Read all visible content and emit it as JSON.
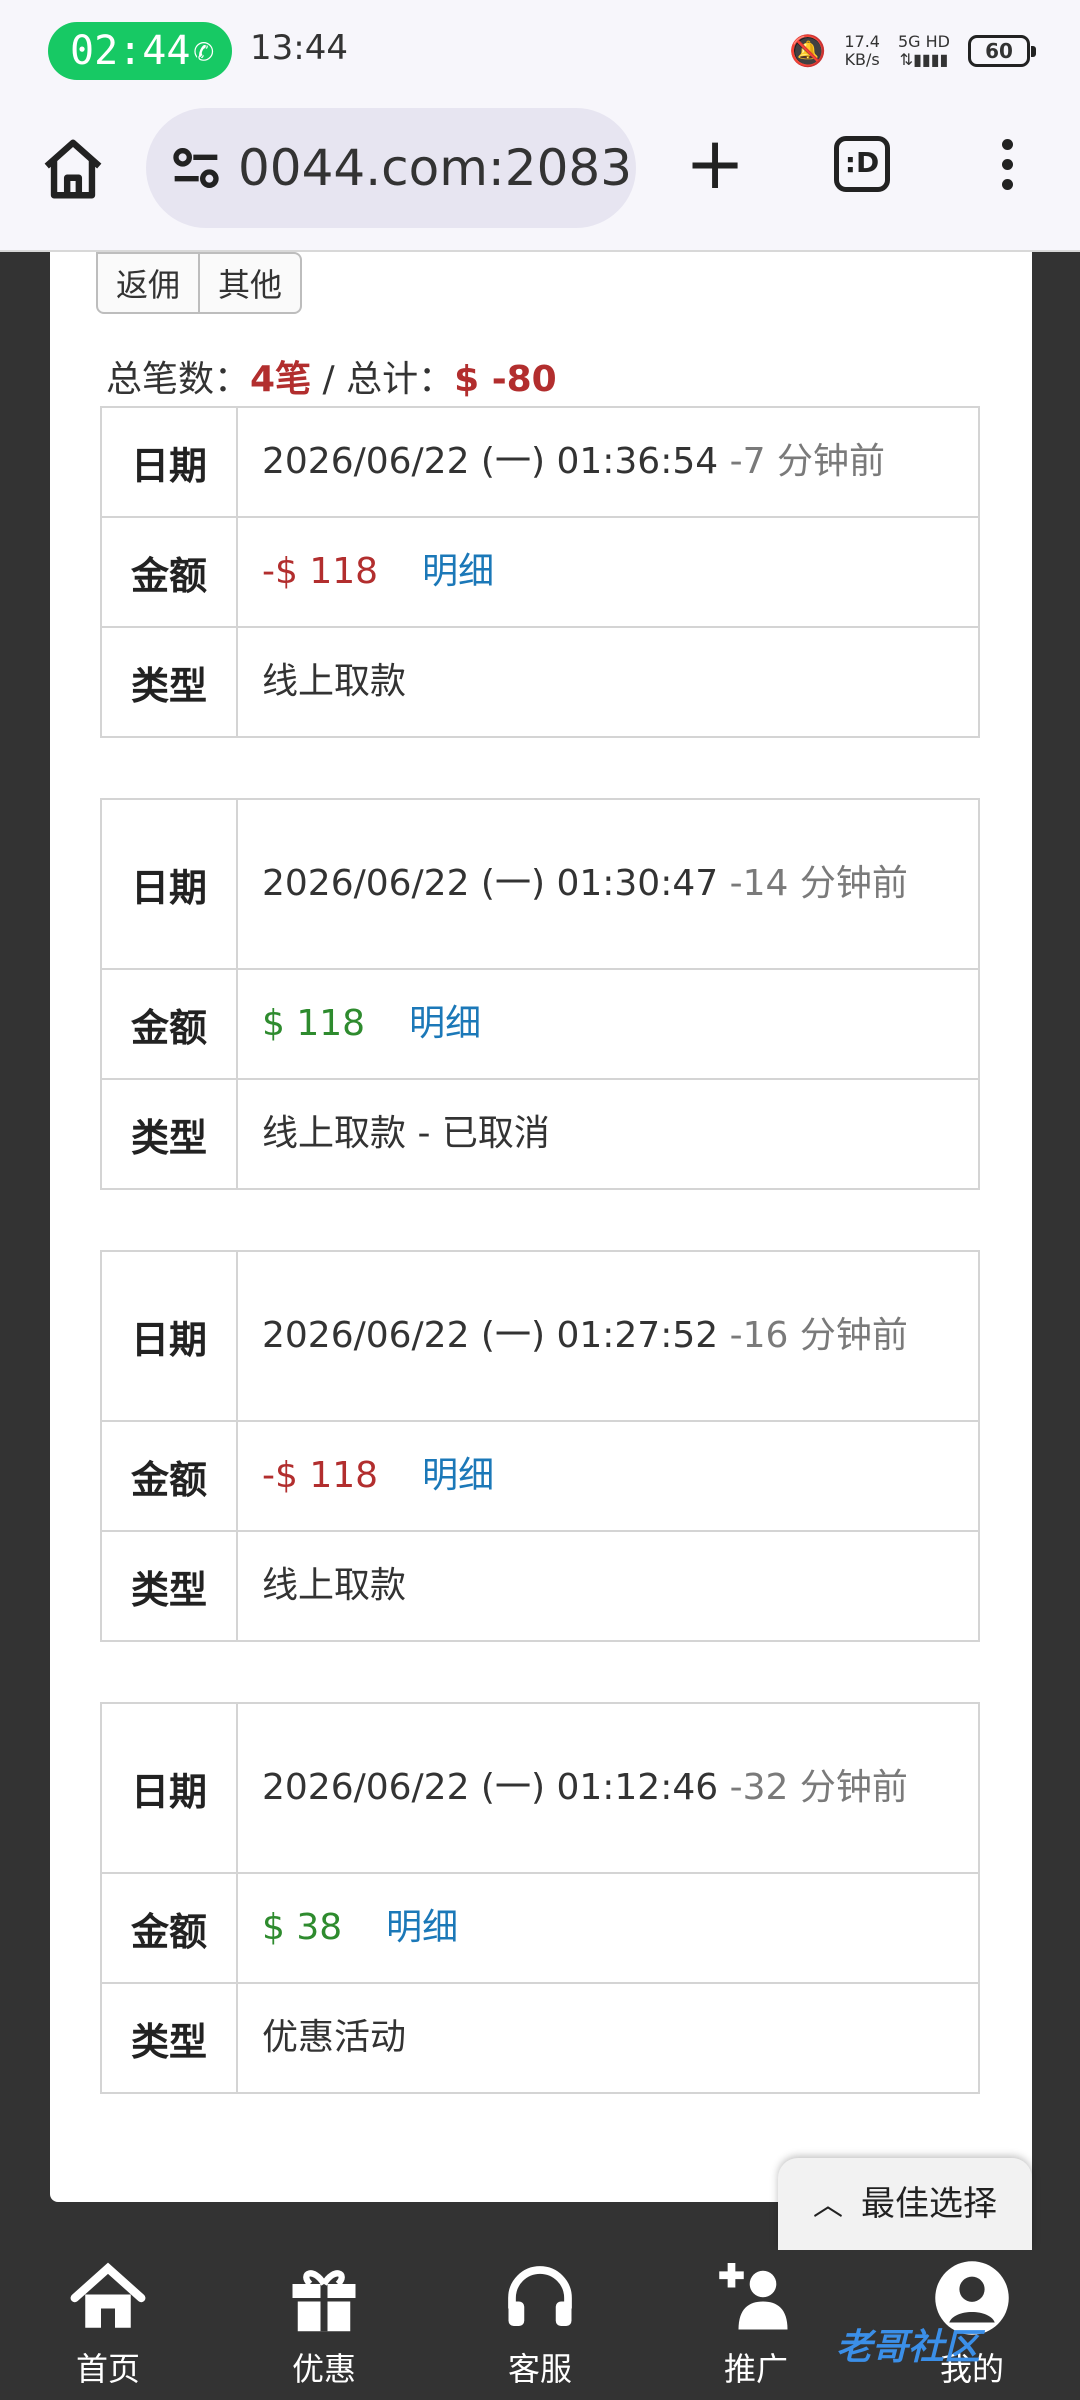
{
  "status_bar": {
    "call_time": "02:44",
    "clock": "13:44",
    "net_speed": "17.4",
    "net_unit": "KB/s",
    "signal_label": "5G HD",
    "battery": "60"
  },
  "browser": {
    "url": "0044.com:2083",
    "tabs_label": ":D"
  },
  "filters": [
    "返佣",
    "其他"
  ],
  "summary": {
    "prefix": "总笔数：",
    "count": "4笔",
    "sep": " / 总计：",
    "total": "$ -80"
  },
  "labels": {
    "date": "日期",
    "amount": "金额",
    "type": "类型",
    "detail": "明细"
  },
  "records": [
    {
      "date": "2026/06/22 (一) 01:36:54",
      "ago": " -7 分钟前",
      "amount": "-$ 118",
      "sign": "neg",
      "type": "线上取款"
    },
    {
      "date": "2026/06/22 (一) 01:30:47",
      "ago": " -14 分钟前",
      "amount": "$ 118",
      "sign": "pos",
      "type": "线上取款 - 已取消"
    },
    {
      "date": "2026/06/22 (一) 01:27:52",
      "ago": " -16 分钟前",
      "amount": "-$ 118",
      "sign": "neg",
      "type": "线上取款"
    },
    {
      "date": "2026/06/22 (一) 01:12:46",
      "ago": " -32 分钟前",
      "amount": "$ 38",
      "sign": "pos",
      "type": "优惠活动"
    }
  ],
  "best_choice": "最佳选择",
  "bottom_nav": [
    {
      "label": "首页",
      "icon": "home-icon"
    },
    {
      "label": "优惠",
      "icon": "gift-icon"
    },
    {
      "label": "客服",
      "icon": "headset-icon"
    },
    {
      "label": "推广",
      "icon": "add-user-icon"
    },
    {
      "label": "我的",
      "icon": "user-icon"
    }
  ],
  "watermark": "老哥社区"
}
